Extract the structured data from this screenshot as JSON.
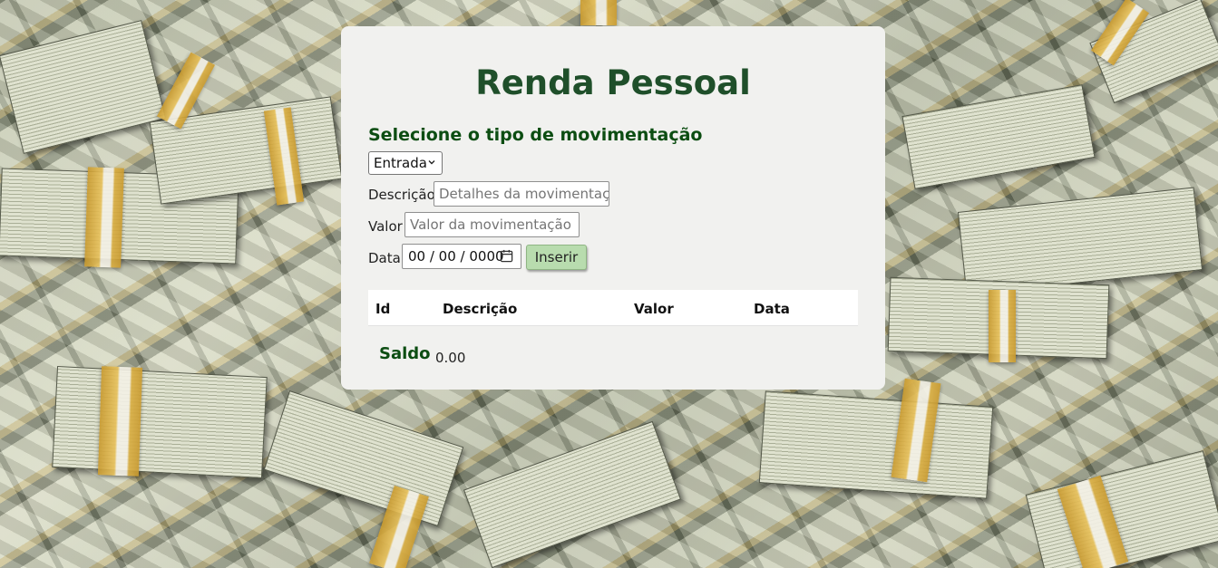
{
  "page": {
    "title": "Renda Pessoal"
  },
  "form": {
    "subtitle": "Selecione o tipo de movimentação",
    "tipo": {
      "selected": "Entrada"
    },
    "descricao": {
      "label": "Descrição",
      "placeholder": "Detalhes da movimentação"
    },
    "valor": {
      "label": "Valor",
      "placeholder": "Valor da movimentação"
    },
    "data": {
      "label": "Data",
      "value": "00 / 00 / 0000"
    },
    "submit_label": "Inserir"
  },
  "table": {
    "headers": [
      "Id",
      "Descrição",
      "Valor",
      "Data"
    ],
    "rows": []
  },
  "saldo": {
    "label": "Saldo",
    "value": "0.00"
  },
  "colors": {
    "title": "#1f4f2a",
    "accent_green": "#0c4d12",
    "button_bg": "#b8dcae",
    "panel_bg": "#f1f1ef"
  },
  "icons": {
    "select_chevron": "chevron-down-icon",
    "date_picker": "calendar-icon"
  }
}
